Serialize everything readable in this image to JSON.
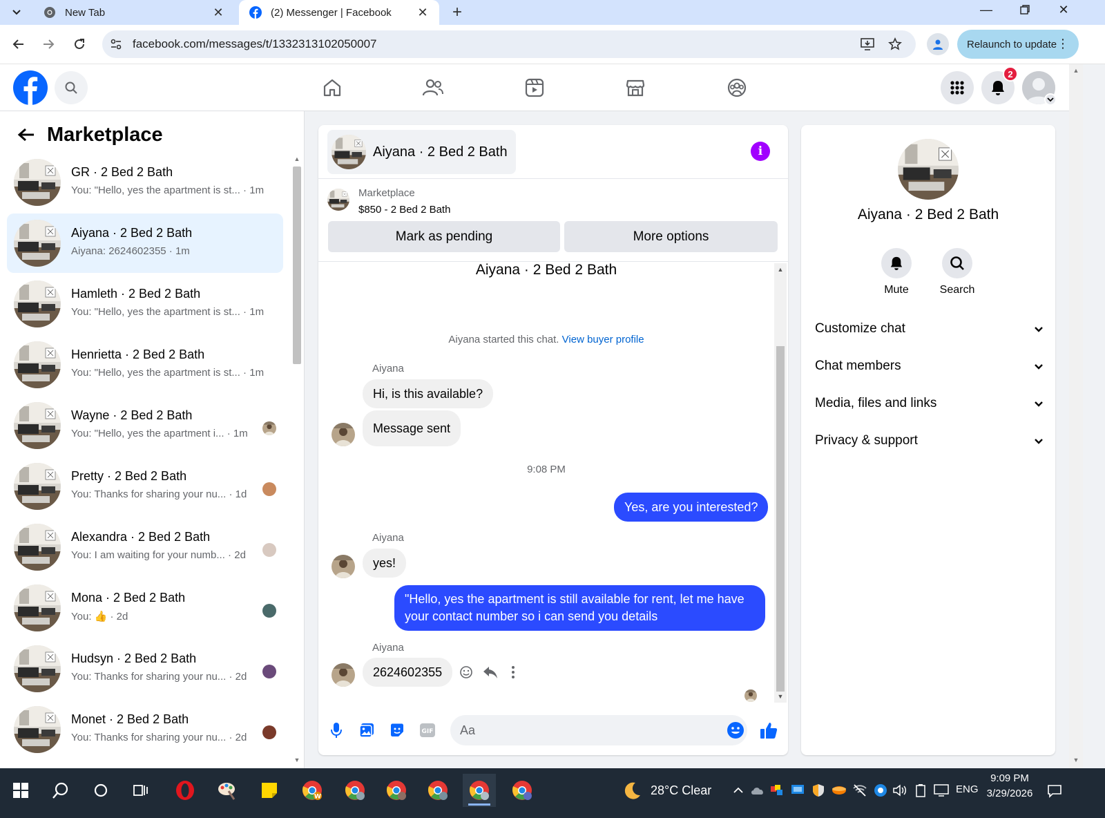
{
  "browser": {
    "tabs": [
      {
        "title": "New Tab",
        "icon": "chrome-icon"
      },
      {
        "title": "(2) Messenger | Facebook",
        "icon": "facebook-icon"
      }
    ],
    "url": "facebook.com/messages/t/1332313102050007",
    "relaunch_label": "Relaunch to update"
  },
  "fbnav": {
    "notification_count": "2"
  },
  "sidebar": {
    "title": "Marketplace",
    "conversations": [
      {
        "name": "GR · 2 Bed 2 Bath",
        "snippet": "You: \"Hello, yes the apartment is st... · 1m"
      },
      {
        "name": "Aiyana · 2 Bed 2 Bath",
        "snippet": "Aiyana: 2624602355 · 1m"
      },
      {
        "name": "Hamleth · 2 Bed 2 Bath",
        "snippet": "You: \"Hello, yes the apartment is st... · 1m"
      },
      {
        "name": "Henrietta · 2 Bed 2 Bath",
        "snippet": "You: \"Hello, yes the apartment is st... · 1m"
      },
      {
        "name": "Wayne · 2 Bed 2 Bath",
        "snippet": "You: \"Hello, yes the apartment i... · 1m"
      },
      {
        "name": "Pretty · 2 Bed 2 Bath",
        "snippet": "You: Thanks for sharing your nu... · 1d"
      },
      {
        "name": "Alexandra · 2 Bed 2 Bath",
        "snippet": "You: I am waiting for your numb... · 2d"
      },
      {
        "name": "Mona · 2 Bed 2 Bath",
        "snippet": "You: 👍 · 2d"
      },
      {
        "name": "Hudsyn · 2 Bed 2 Bath",
        "snippet": "You: Thanks for sharing your nu... · 2d"
      },
      {
        "name": "Monet · 2 Bed 2 Bath",
        "snippet": "You: Thanks for sharing your nu... · 2d"
      }
    ]
  },
  "chat": {
    "header_name": "Aiyana · 2 Bed 2 Bath",
    "listing_source": "Marketplace",
    "listing_title": "$850 - 2 Bed 2 Bath",
    "mark_pending_label": "Mark as pending",
    "more_options_label": "More options",
    "conversation_title": "Aiyana · 2 Bed 2 Bath",
    "started_text": "Aiyana started this chat.",
    "view_profile_link": "View buyer profile",
    "sender_name": "Aiyana",
    "msg1": "Hi, is this available?",
    "msg2": "Message sent",
    "timestamp": "9:08 PM",
    "msg3": "Yes, are you interested?",
    "msg4": "yes!",
    "msg5": "\"Hello, yes the apartment is still available for rent, let me have your contact number so i can send you details",
    "msg6": "2624602355",
    "composer_placeholder": "Aa"
  },
  "info": {
    "name": "Aiyana · 2 Bed 2 Bath",
    "mute_label": "Mute",
    "search_label": "Search",
    "sections": [
      "Customize chat",
      "Chat members",
      "Media, files and links",
      "Privacy & support"
    ]
  },
  "taskbar": {
    "weather": "28°C  Clear",
    "language": "ENG",
    "time": "9:09 PM",
    "date": "3/29/2026"
  },
  "colors": {
    "facebook_blue": "#0866ff",
    "outgoing_bubble": "#2b4bff",
    "selected_row": "#e7f3ff",
    "info_purple": "#a100ff"
  }
}
